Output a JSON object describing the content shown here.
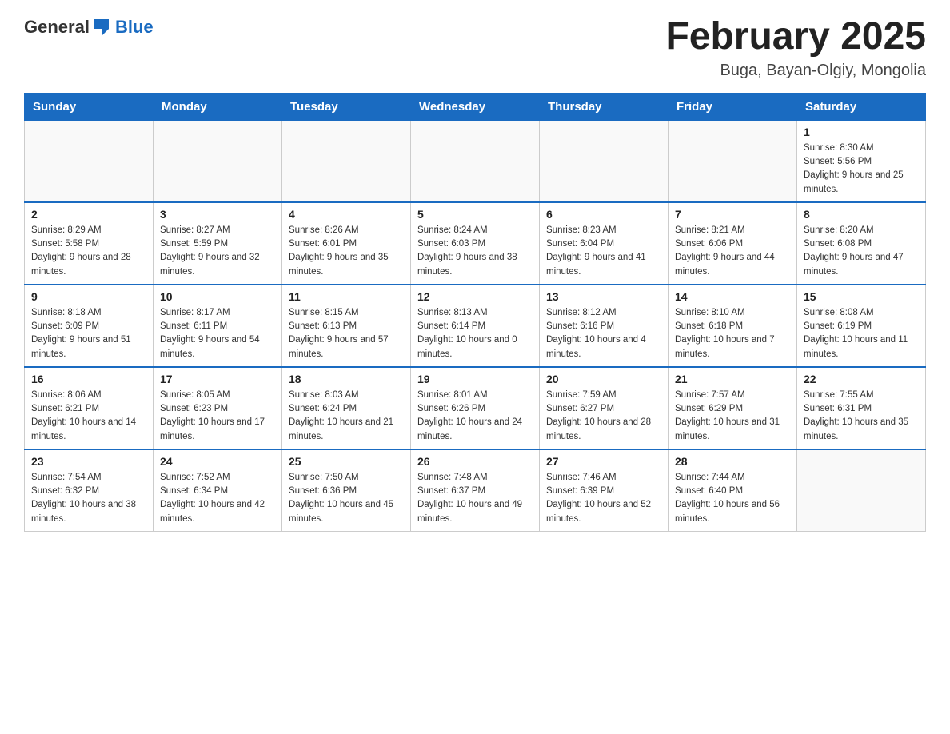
{
  "header": {
    "logo": {
      "text_general": "General",
      "text_blue": "Blue"
    },
    "title": "February 2025",
    "subtitle": "Buga, Bayan-Olgiy, Mongolia"
  },
  "weekdays": [
    "Sunday",
    "Monday",
    "Tuesday",
    "Wednesday",
    "Thursday",
    "Friday",
    "Saturday"
  ],
  "weeks": [
    [
      {
        "day": "",
        "sunrise": "",
        "sunset": "",
        "daylight": ""
      },
      {
        "day": "",
        "sunrise": "",
        "sunset": "",
        "daylight": ""
      },
      {
        "day": "",
        "sunrise": "",
        "sunset": "",
        "daylight": ""
      },
      {
        "day": "",
        "sunrise": "",
        "sunset": "",
        "daylight": ""
      },
      {
        "day": "",
        "sunrise": "",
        "sunset": "",
        "daylight": ""
      },
      {
        "day": "",
        "sunrise": "",
        "sunset": "",
        "daylight": ""
      },
      {
        "day": "1",
        "sunrise": "Sunrise: 8:30 AM",
        "sunset": "Sunset: 5:56 PM",
        "daylight": "Daylight: 9 hours and 25 minutes."
      }
    ],
    [
      {
        "day": "2",
        "sunrise": "Sunrise: 8:29 AM",
        "sunset": "Sunset: 5:58 PM",
        "daylight": "Daylight: 9 hours and 28 minutes."
      },
      {
        "day": "3",
        "sunrise": "Sunrise: 8:27 AM",
        "sunset": "Sunset: 5:59 PM",
        "daylight": "Daylight: 9 hours and 32 minutes."
      },
      {
        "day": "4",
        "sunrise": "Sunrise: 8:26 AM",
        "sunset": "Sunset: 6:01 PM",
        "daylight": "Daylight: 9 hours and 35 minutes."
      },
      {
        "day": "5",
        "sunrise": "Sunrise: 8:24 AM",
        "sunset": "Sunset: 6:03 PM",
        "daylight": "Daylight: 9 hours and 38 minutes."
      },
      {
        "day": "6",
        "sunrise": "Sunrise: 8:23 AM",
        "sunset": "Sunset: 6:04 PM",
        "daylight": "Daylight: 9 hours and 41 minutes."
      },
      {
        "day": "7",
        "sunrise": "Sunrise: 8:21 AM",
        "sunset": "Sunset: 6:06 PM",
        "daylight": "Daylight: 9 hours and 44 minutes."
      },
      {
        "day": "8",
        "sunrise": "Sunrise: 8:20 AM",
        "sunset": "Sunset: 6:08 PM",
        "daylight": "Daylight: 9 hours and 47 minutes."
      }
    ],
    [
      {
        "day": "9",
        "sunrise": "Sunrise: 8:18 AM",
        "sunset": "Sunset: 6:09 PM",
        "daylight": "Daylight: 9 hours and 51 minutes."
      },
      {
        "day": "10",
        "sunrise": "Sunrise: 8:17 AM",
        "sunset": "Sunset: 6:11 PM",
        "daylight": "Daylight: 9 hours and 54 minutes."
      },
      {
        "day": "11",
        "sunrise": "Sunrise: 8:15 AM",
        "sunset": "Sunset: 6:13 PM",
        "daylight": "Daylight: 9 hours and 57 minutes."
      },
      {
        "day": "12",
        "sunrise": "Sunrise: 8:13 AM",
        "sunset": "Sunset: 6:14 PM",
        "daylight": "Daylight: 10 hours and 0 minutes."
      },
      {
        "day": "13",
        "sunrise": "Sunrise: 8:12 AM",
        "sunset": "Sunset: 6:16 PM",
        "daylight": "Daylight: 10 hours and 4 minutes."
      },
      {
        "day": "14",
        "sunrise": "Sunrise: 8:10 AM",
        "sunset": "Sunset: 6:18 PM",
        "daylight": "Daylight: 10 hours and 7 minutes."
      },
      {
        "day": "15",
        "sunrise": "Sunrise: 8:08 AM",
        "sunset": "Sunset: 6:19 PM",
        "daylight": "Daylight: 10 hours and 11 minutes."
      }
    ],
    [
      {
        "day": "16",
        "sunrise": "Sunrise: 8:06 AM",
        "sunset": "Sunset: 6:21 PM",
        "daylight": "Daylight: 10 hours and 14 minutes."
      },
      {
        "day": "17",
        "sunrise": "Sunrise: 8:05 AM",
        "sunset": "Sunset: 6:23 PM",
        "daylight": "Daylight: 10 hours and 17 minutes."
      },
      {
        "day": "18",
        "sunrise": "Sunrise: 8:03 AM",
        "sunset": "Sunset: 6:24 PM",
        "daylight": "Daylight: 10 hours and 21 minutes."
      },
      {
        "day": "19",
        "sunrise": "Sunrise: 8:01 AM",
        "sunset": "Sunset: 6:26 PM",
        "daylight": "Daylight: 10 hours and 24 minutes."
      },
      {
        "day": "20",
        "sunrise": "Sunrise: 7:59 AM",
        "sunset": "Sunset: 6:27 PM",
        "daylight": "Daylight: 10 hours and 28 minutes."
      },
      {
        "day": "21",
        "sunrise": "Sunrise: 7:57 AM",
        "sunset": "Sunset: 6:29 PM",
        "daylight": "Daylight: 10 hours and 31 minutes."
      },
      {
        "day": "22",
        "sunrise": "Sunrise: 7:55 AM",
        "sunset": "Sunset: 6:31 PM",
        "daylight": "Daylight: 10 hours and 35 minutes."
      }
    ],
    [
      {
        "day": "23",
        "sunrise": "Sunrise: 7:54 AM",
        "sunset": "Sunset: 6:32 PM",
        "daylight": "Daylight: 10 hours and 38 minutes."
      },
      {
        "day": "24",
        "sunrise": "Sunrise: 7:52 AM",
        "sunset": "Sunset: 6:34 PM",
        "daylight": "Daylight: 10 hours and 42 minutes."
      },
      {
        "day": "25",
        "sunrise": "Sunrise: 7:50 AM",
        "sunset": "Sunset: 6:36 PM",
        "daylight": "Daylight: 10 hours and 45 minutes."
      },
      {
        "day": "26",
        "sunrise": "Sunrise: 7:48 AM",
        "sunset": "Sunset: 6:37 PM",
        "daylight": "Daylight: 10 hours and 49 minutes."
      },
      {
        "day": "27",
        "sunrise": "Sunrise: 7:46 AM",
        "sunset": "Sunset: 6:39 PM",
        "daylight": "Daylight: 10 hours and 52 minutes."
      },
      {
        "day": "28",
        "sunrise": "Sunrise: 7:44 AM",
        "sunset": "Sunset: 6:40 PM",
        "daylight": "Daylight: 10 hours and 56 minutes."
      },
      {
        "day": "",
        "sunrise": "",
        "sunset": "",
        "daylight": ""
      }
    ]
  ]
}
